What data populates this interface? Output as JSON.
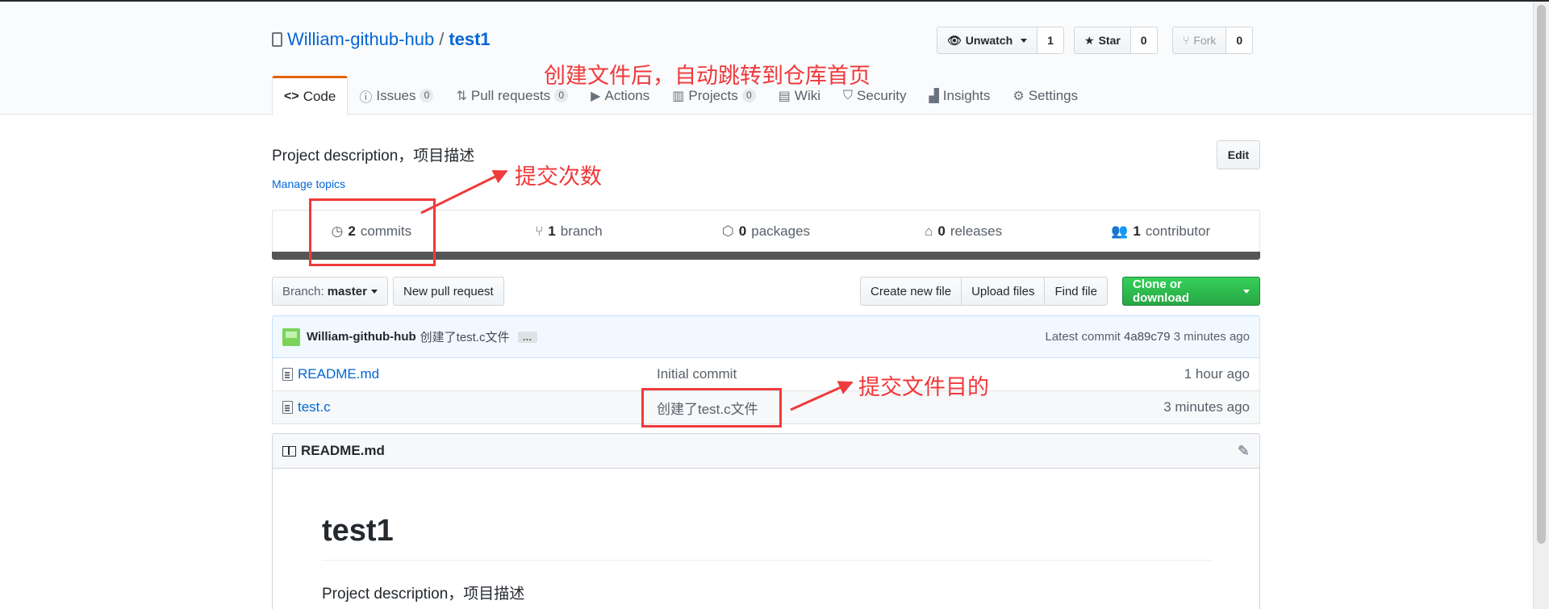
{
  "repo": {
    "owner": "William-github-hub",
    "separator": "/",
    "name": "test1"
  },
  "social": {
    "watch_label": "Unwatch",
    "watch_count": "1",
    "star_label": "Star",
    "star_count": "0",
    "fork_label": "Fork",
    "fork_count": "0"
  },
  "tabs": [
    {
      "label": "Code",
      "icon": "code-icon"
    },
    {
      "label": "Issues",
      "count": "0",
      "icon": "issue-icon"
    },
    {
      "label": "Pull requests",
      "count": "0",
      "icon": "pull-request-icon"
    },
    {
      "label": "Actions",
      "icon": "play-icon"
    },
    {
      "label": "Projects",
      "count": "0",
      "icon": "project-icon"
    },
    {
      "label": "Wiki",
      "icon": "book-icon"
    },
    {
      "label": "Security",
      "icon": "shield-icon"
    },
    {
      "label": "Insights",
      "icon": "graph-icon"
    },
    {
      "label": "Settings",
      "icon": "gear-icon"
    }
  ],
  "description": "Project description，项目描述",
  "manage_topics": "Manage topics",
  "edit_label": "Edit",
  "summary": {
    "commits_num": "2",
    "commits_label": "commits",
    "branch_num": "1",
    "branch_label": "branch",
    "packages_num": "0",
    "packages_label": "packages",
    "releases_num": "0",
    "releases_label": "releases",
    "contributors_num": "1",
    "contributors_label": "contributor"
  },
  "file_nav": {
    "branch_label": "Branch:",
    "branch_value": "master",
    "new_pr": "New pull request",
    "create_file": "Create new file",
    "upload_files": "Upload files",
    "find_file": "Find file",
    "clone": "Clone or download"
  },
  "latest_commit": {
    "author": "William-github-hub",
    "message": "创建了test.c文件",
    "ellipsis": "…",
    "prefix": "Latest commit",
    "sha": "4a89c79",
    "age": "3 minutes ago"
  },
  "files": [
    {
      "name": "README.md",
      "message": "Initial commit",
      "age": "1 hour ago"
    },
    {
      "name": "test.c",
      "message": "创建了test.c文件",
      "age": "3 minutes ago"
    }
  ],
  "readme": {
    "filename": "README.md",
    "heading": "test1",
    "body": "Project description，项目描述"
  },
  "annotations": {
    "redirect_note": "创建文件后，自动跳转到仓库首页",
    "commits_note": "提交次数",
    "purpose_note": "提交文件目的"
  },
  "colors": {
    "accent": "#0366d6",
    "annotation": "#f0383a",
    "clone_button": "#28a745",
    "active_tab": "#e36209"
  }
}
